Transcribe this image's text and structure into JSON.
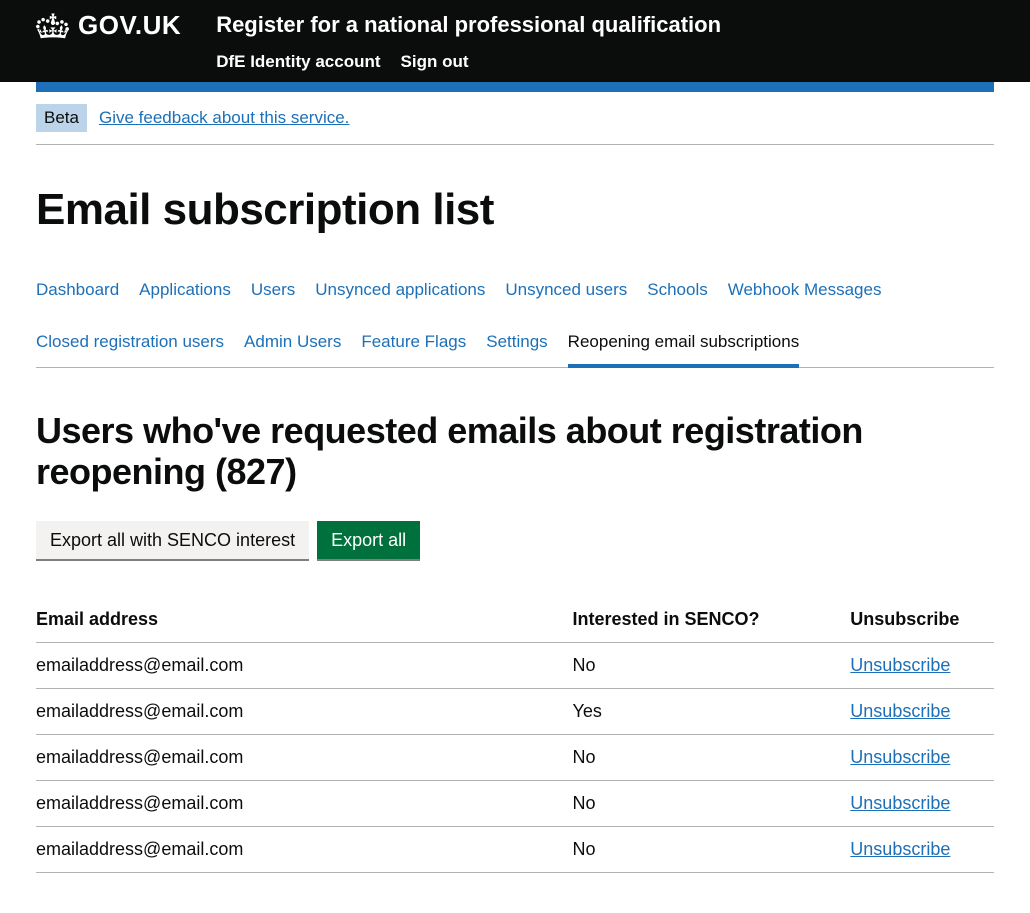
{
  "header": {
    "logo_text": "GOV.UK",
    "service_name": "Register for a national professional qualification",
    "nav": {
      "identity": "DfE Identity account",
      "signout": "Sign out"
    }
  },
  "phase": {
    "tag": "Beta",
    "feedback": "Give feedback about this service."
  },
  "page_title": "Email subscription list",
  "sub_nav": [
    "Dashboard",
    "Applications",
    "Users",
    "Unsynced applications",
    "Unsynced users",
    "Schools",
    "Webhook Messages",
    "Closed registration users",
    "Admin Users",
    "Feature Flags",
    "Settings",
    "Reopening email subscriptions"
  ],
  "sub_nav_active_index": 11,
  "section_heading_prefix": "Users who've requested emails about registration reopening (",
  "section_count": "827",
  "section_heading_suffix": ")",
  "buttons": {
    "export_senco": "Export all with SENCO interest",
    "export_all": "Export all"
  },
  "table": {
    "headers": {
      "email": "Email address",
      "senco": "Interested in SENCO?",
      "unsub": "Unsubscribe"
    },
    "unsubscribe_label": "Unsubscribe",
    "rows": [
      {
        "email": "emailaddress@email.com",
        "senco": "No"
      },
      {
        "email": "emailaddress@email.com",
        "senco": "Yes"
      },
      {
        "email": "emailaddress@email.com",
        "senco": "No"
      },
      {
        "email": "emailaddress@email.com",
        "senco": "No"
      },
      {
        "email": "emailaddress@email.com",
        "senco": "No"
      }
    ]
  }
}
